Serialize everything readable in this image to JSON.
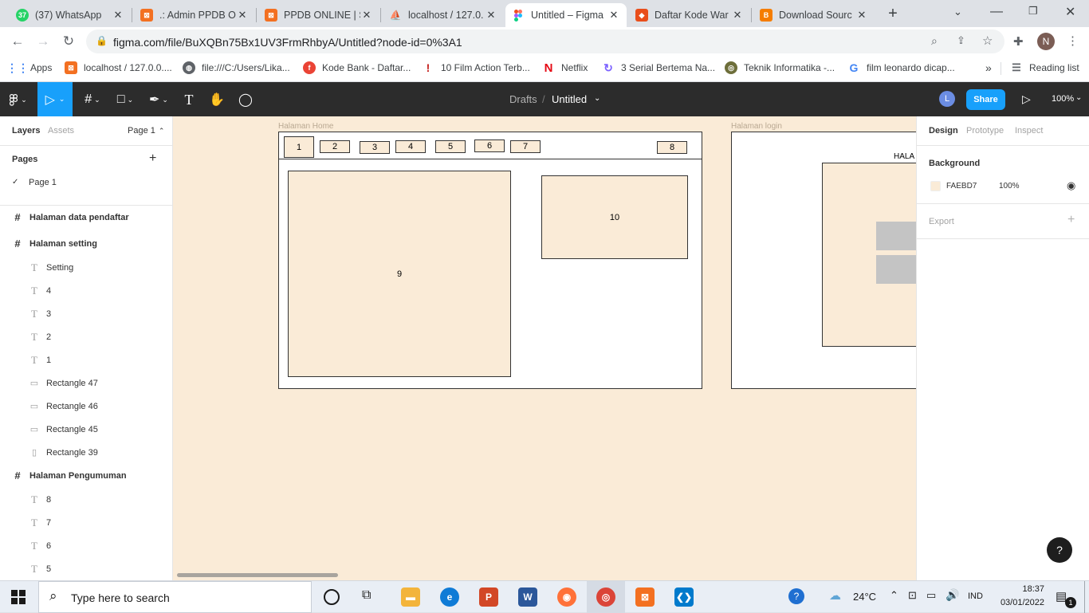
{
  "browser": {
    "tabs": [
      {
        "title": "(37) WhatsApp",
        "badge": "37",
        "color": "#25d366",
        "active": false
      },
      {
        "title": ".: Admin PPDB Or",
        "color": "#f37021",
        "active": false
      },
      {
        "title": "PPDB ONLINE | S",
        "color": "#f37021",
        "active": false
      },
      {
        "title": "localhost / 127.0.",
        "color": "#f29111",
        "active": false
      },
      {
        "title": "Untitled – Figma",
        "color": "#a259ff",
        "active": true
      },
      {
        "title": "Daftar Kode War",
        "color": "#e94e1b",
        "active": false
      },
      {
        "title": "Download Sourc",
        "color": "#f57d00",
        "active": false
      }
    ],
    "new_tab_symbol": "+",
    "url": "figma.com/file/BuXQBn75Bx1UV3FrmRhbyA/Untitled?node-id=0%3A1",
    "profile_initial": "N",
    "bookmarks": [
      {
        "label": "Apps",
        "color": "#4285f4"
      },
      {
        "label": "localhost / 127.0.0....",
        "color": "#f37021"
      },
      {
        "label": "file:///C:/Users/Lika...",
        "color": "#5f6368"
      },
      {
        "label": "Kode Bank - Daftar...",
        "color": "#ea4335"
      },
      {
        "label": "10 Film Action Terb...",
        "color": "#c5221f"
      },
      {
        "label": "Netflix",
        "color": "#e50914"
      },
      {
        "label": "3 Serial Bertema Na...",
        "color": "#7b61ff"
      },
      {
        "label": "Teknik Informatika -...",
        "color": "#6d6e3a"
      },
      {
        "label": "film leonardo dicap...",
        "color": "#4285f4"
      }
    ],
    "more_bookmarks": "»",
    "reading_list": "Reading list"
  },
  "figma": {
    "breadcrumb_drafts": "Drafts",
    "breadcrumb_sep": "/",
    "file_name": "Untitled",
    "user_avatar": "L",
    "share_label": "Share",
    "zoom_label": "100%",
    "left_tabs": {
      "layers": "Layers",
      "assets": "Assets",
      "page_selector": "Page 1"
    },
    "pages_heading": "Pages",
    "pages": [
      {
        "label": "Page 1"
      }
    ],
    "layers": [
      {
        "label": "Halaman data pendaftar",
        "kind": "frame"
      },
      {
        "label": "Halaman setting",
        "kind": "frame"
      },
      {
        "label": "Setting",
        "kind": "text"
      },
      {
        "label": "4",
        "kind": "text"
      },
      {
        "label": "3",
        "kind": "text"
      },
      {
        "label": "2",
        "kind": "text"
      },
      {
        "label": "1",
        "kind": "text"
      },
      {
        "label": "Rectangle 47",
        "kind": "rect"
      },
      {
        "label": "Rectangle 46",
        "kind": "rect"
      },
      {
        "label": "Rectangle 45",
        "kind": "rect"
      },
      {
        "label": "Rectangle 39",
        "kind": "line"
      },
      {
        "label": "Halaman Pengumuman",
        "kind": "frame"
      },
      {
        "label": "8",
        "kind": "text"
      },
      {
        "label": "7",
        "kind": "text"
      },
      {
        "label": "6",
        "kind": "text"
      },
      {
        "label": "5",
        "kind": "text"
      }
    ],
    "canvas": {
      "background": "#faebd7",
      "home_label": "Halaman Home",
      "login_label": "Halaman login",
      "nav_boxes": [
        "1",
        "2",
        "3",
        "4",
        "5",
        "6",
        "7",
        "8"
      ],
      "box_9": "9",
      "box_10": "10",
      "login_heading": "HALA"
    },
    "right_tabs": {
      "design": "Design",
      "prototype": "Prototype",
      "inspect": "Inspect"
    },
    "background_heading": "Background",
    "background_hex": "FAEBD7",
    "background_opacity": "100%",
    "export_heading": "Export",
    "help_symbol": "?"
  },
  "taskbar": {
    "search_placeholder": "Type here to search",
    "weather": "24°C",
    "language": "IND",
    "time": "18:37",
    "date": "03/01/2022",
    "notifications": "1"
  }
}
